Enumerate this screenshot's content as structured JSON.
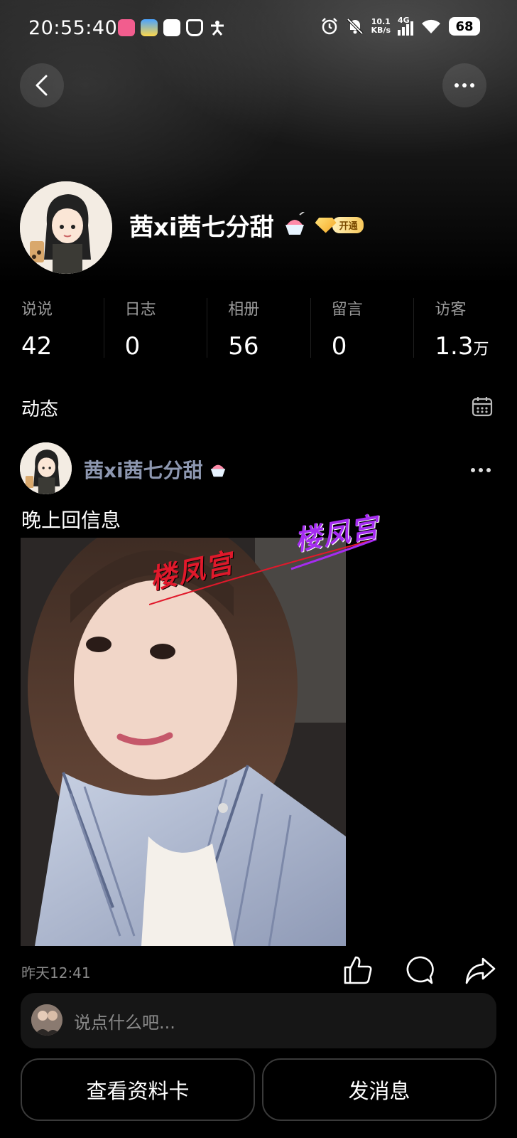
{
  "status_bar": {
    "time": "20:55:40",
    "net_speed_value": "10.1",
    "net_speed_unit": "KB/s",
    "network_type": "4G",
    "battery": "68"
  },
  "profile": {
    "nickname": "茜xi茜七分甜",
    "vip_tag": "开通"
  },
  "stats": [
    {
      "label": "说说",
      "value": "42",
      "unit": ""
    },
    {
      "label": "日志",
      "value": "0",
      "unit": ""
    },
    {
      "label": "相册",
      "value": "56",
      "unit": ""
    },
    {
      "label": "留言",
      "value": "0",
      "unit": ""
    },
    {
      "label": "访客",
      "value": "1.3",
      "unit": "万"
    }
  ],
  "feed": {
    "section_title": "动态",
    "post": {
      "author": "茜xi茜七分甜",
      "text": "晚上回信息",
      "watermark_1": "楼凤宫",
      "watermark_2": "楼凤宫",
      "time": "昨天12:41"
    },
    "comment_placeholder": "说点什么吧..."
  },
  "actions": {
    "view_profile_card": "查看资料卡",
    "send_message": "发消息"
  },
  "colors": {
    "background": "#000000",
    "author_name": "#8d97b0",
    "watermark_red": "#e0192b",
    "watermark_purple": "#a52cf0"
  }
}
